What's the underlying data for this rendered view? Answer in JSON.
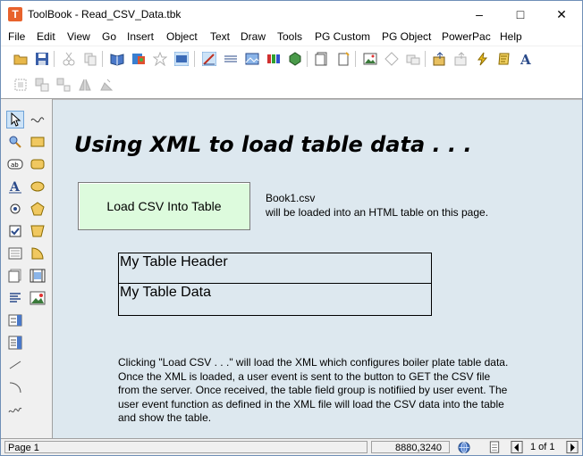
{
  "window": {
    "title": "ToolBook - Read_CSV_Data.tbk",
    "app_icon_letter": "T",
    "controls": {
      "minimize": "–",
      "maximize": "□",
      "close": "✕"
    }
  },
  "menubar": {
    "items": [
      "File",
      "Edit",
      "View",
      "Go",
      "Insert",
      "Object",
      "Text",
      "Draw",
      "Tools",
      "PG Custom",
      "PG Object",
      "PowerPac",
      "Help"
    ]
  },
  "page": {
    "heading": "Using XML to load table data . . .",
    "load_button": "Load CSV Into Table",
    "file_name": "Book1.csv",
    "file_note": "will be loaded into an HTML table on this page.",
    "table_header": "My Table Header",
    "table_data": "My Table Data",
    "description": "Clicking \"Load CSV . . .\" will load the XML which configures boiler plate table data. Once the XML is loaded, a user event is sent to the button to GET the CSV file from the server. Once received, the table field group is notifiied by user event. The user event function as defined in the XML file will load the CSV data into the table and show the table."
  },
  "statusbar": {
    "page": "Page 1",
    "coords": "8880,3240",
    "page_count": "1 of 1"
  },
  "colors": {
    "canvas": "#dde8ef",
    "button": "#ddfbdd",
    "app_icon": "#e8622c"
  }
}
